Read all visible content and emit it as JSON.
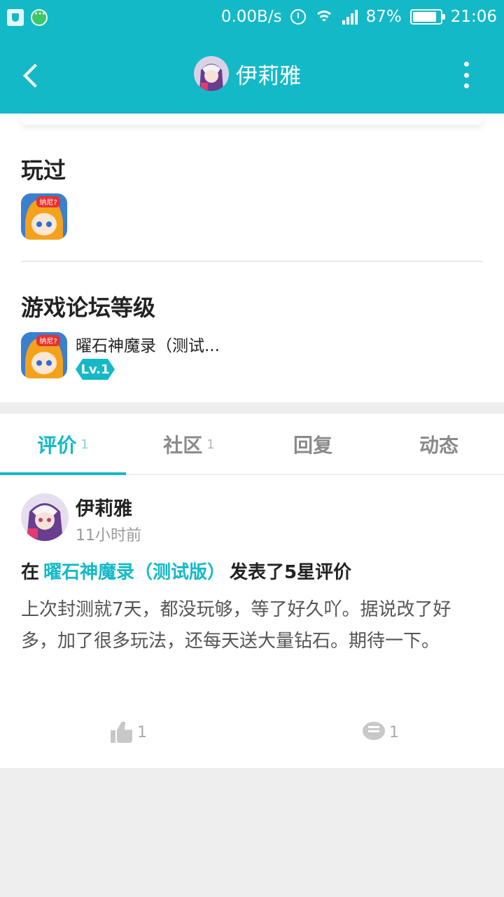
{
  "status_bar": {
    "speed": "0.00B/s",
    "battery": "87%",
    "battery_level": 0.87,
    "time": "21:06"
  },
  "header": {
    "title": "伊莉雅"
  },
  "played": {
    "title": "玩过",
    "games": [
      {
        "icon_text": "纳尼?"
      }
    ]
  },
  "forum_level": {
    "title": "游戏论坛等级",
    "game_name": "曜石神魔录（测试...",
    "level": "Lv.1",
    "icon_text": "纳尼?"
  },
  "tabs": [
    {
      "label": "评价",
      "count": "1"
    },
    {
      "label": "社区",
      "count": "1"
    },
    {
      "label": "回复",
      "count": ""
    },
    {
      "label": "动态",
      "count": ""
    }
  ],
  "post": {
    "author": "伊莉雅",
    "time": "11小时前",
    "prefix": "在",
    "game_link": "曜石神魔录（测试版）",
    "action": "发表了5星评价",
    "body": "上次封测就7天，都没玩够，等了好久吖。据说改了好多，加了很多玩法，还每天送大量钻石。期待一下。",
    "likes": "1",
    "comments": "1"
  },
  "colors": {
    "accent": "#14b9c8"
  }
}
